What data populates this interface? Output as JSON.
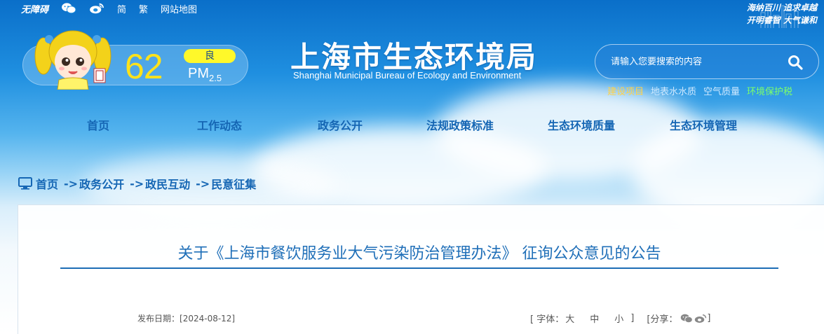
{
  "topbar": {
    "accessibility": "无障碍",
    "wechat_icon": "wechat-icon",
    "weibo_icon": "weibo-icon",
    "simplified": "简",
    "traditional": "繁",
    "sitemap": "网站地图"
  },
  "slogan": {
    "line1": "海纳百川  追求卓越",
    "line2": "开明睿智  大气谦和"
  },
  "aqi": {
    "value": "62",
    "level": "良",
    "pollutant": "PM",
    "pollutant_sub": "2.5"
  },
  "site": {
    "title": "上海市生态环境局",
    "subtitle": "Shanghai Municipal Bureau of Ecology and Environment"
  },
  "search": {
    "placeholder": "请输入您要搜索的内容"
  },
  "quicklinks": [
    {
      "label": "建设项目",
      "color": "#ffd24a"
    },
    {
      "label": "地表水水质",
      "color": "#cfe9ff"
    },
    {
      "label": "空气质量",
      "color": "#cfe9ff"
    },
    {
      "label": "环境保护税",
      "color": "#7dff6a"
    }
  ],
  "nav": {
    "items": [
      "首页",
      "工作动态",
      "政务公开",
      "法规政策标准",
      "生态环境质量",
      "生态环境管理"
    ]
  },
  "breadcrumb": {
    "home": "首页",
    "sep": "->",
    "level1": "政务公开",
    "level2": "政民互动",
    "level3": "民意征集"
  },
  "article": {
    "title": "关于《上海市餐饮服务业大气污染防治管理办法》 征询公众意见的公告",
    "date_label": "发布日期：",
    "date_value": "[2024-08-12]",
    "font_label": "[ 字体：",
    "font_large": "大",
    "font_medium": "中",
    "font_small": "小",
    "font_close": "]",
    "share_label": "[分享：",
    "share_close": "]"
  },
  "colors": {
    "accent": "#1566b4",
    "aqi_value": "#ffe21a",
    "aqi_badge": "#fff82a"
  }
}
